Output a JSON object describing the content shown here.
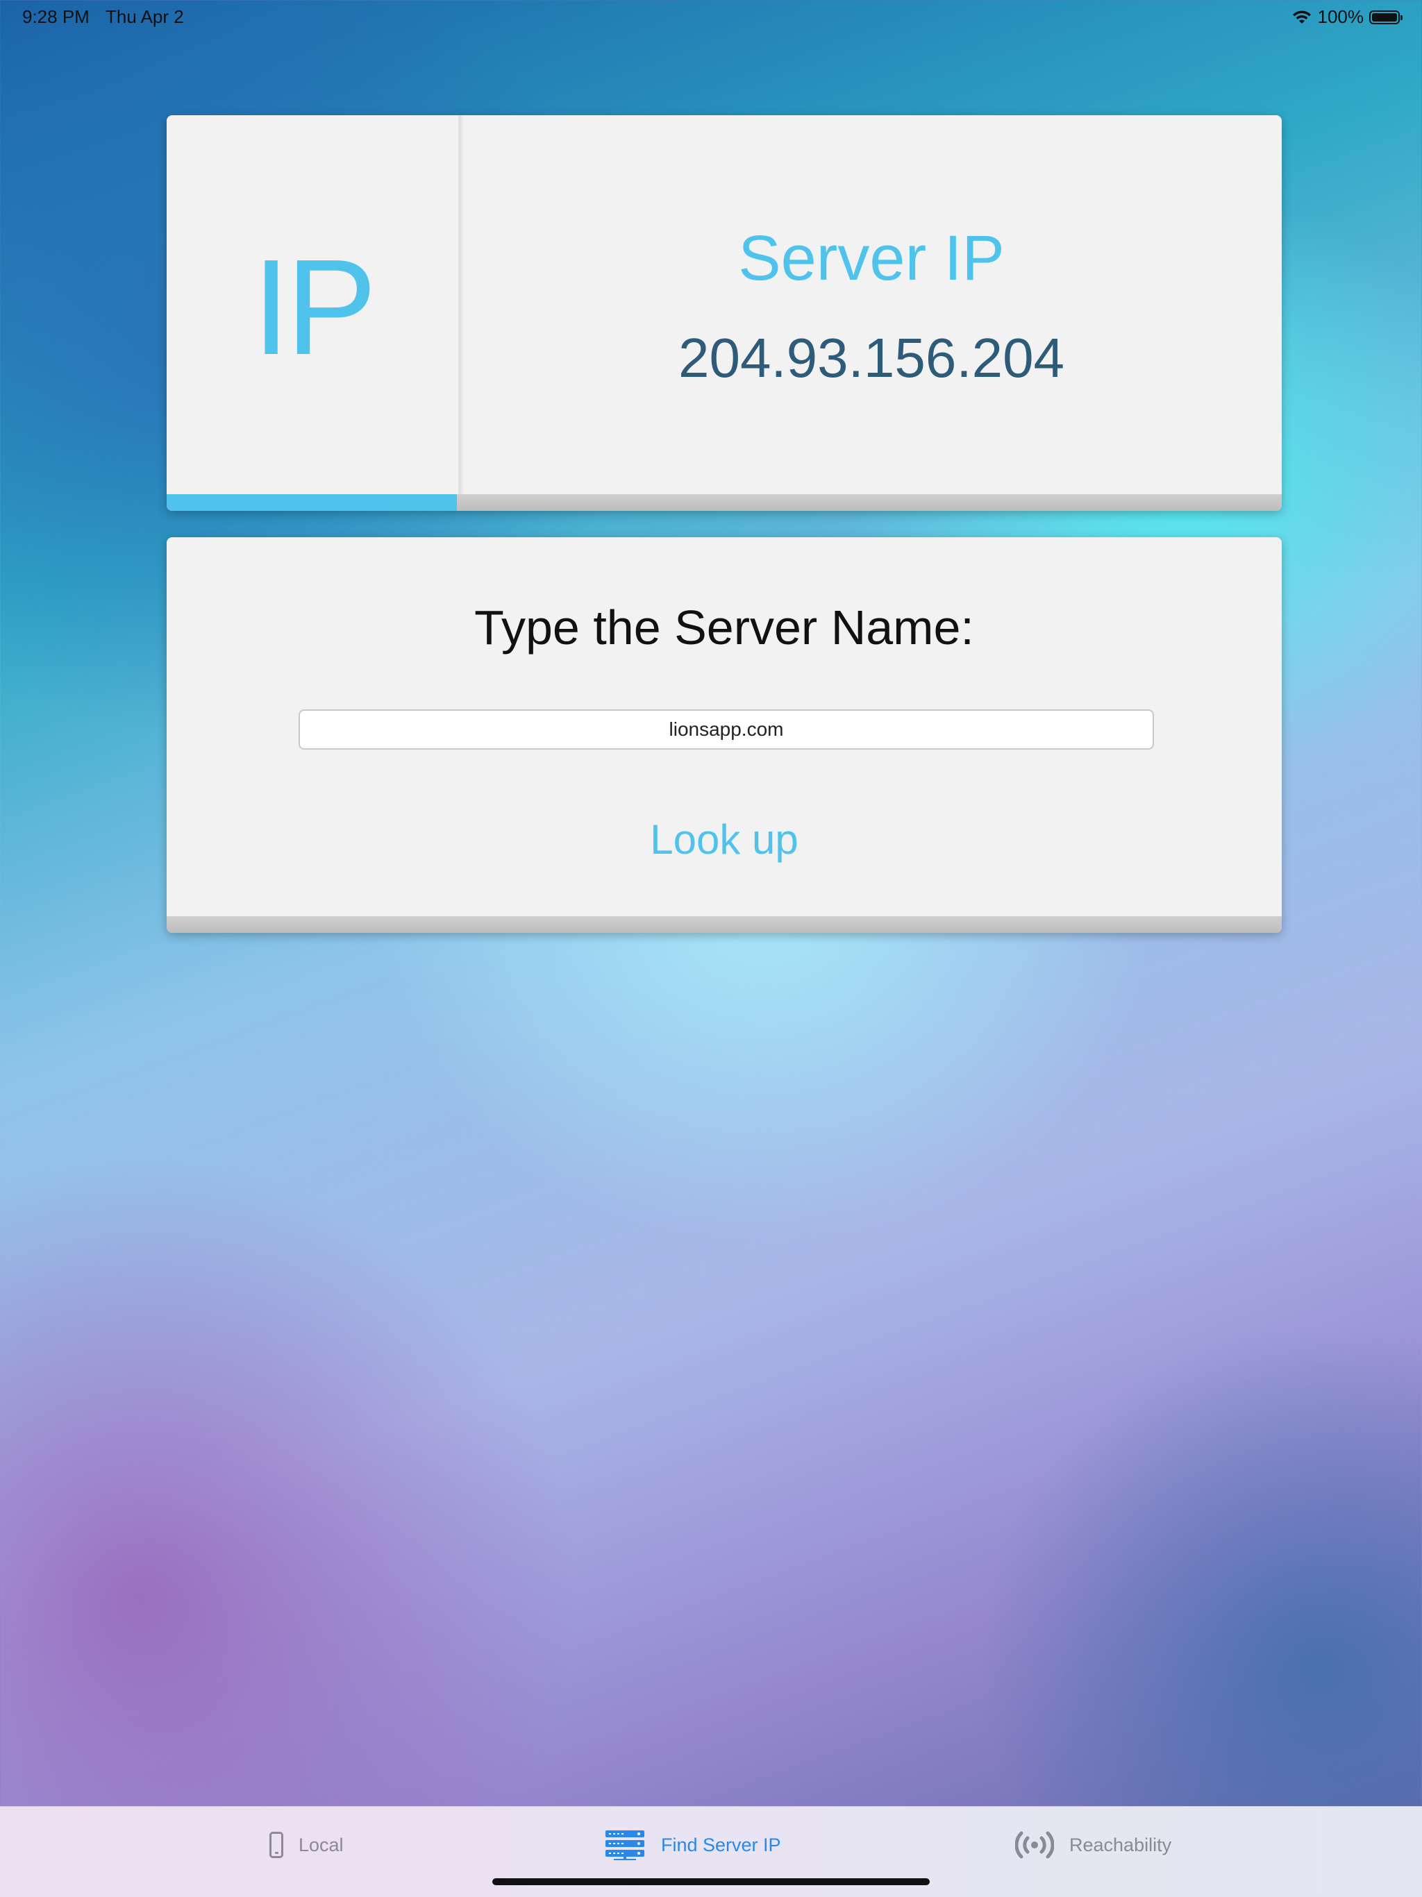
{
  "status_bar": {
    "time": "9:28 PM",
    "date": "Thu Apr 2",
    "battery": "100%"
  },
  "result_card": {
    "icon_text": "IP",
    "label": "Server IP",
    "ip_address": "204.93.156.204",
    "progress_percent": 26
  },
  "lookup_card": {
    "prompt": "Type the Server Name:",
    "server_name": "lionsapp.com",
    "button_label": "Look up"
  },
  "tab_bar": {
    "tabs": [
      {
        "label": "Local",
        "icon": "phone-icon",
        "selected": false
      },
      {
        "label": "Find Server IP",
        "icon": "server-icon",
        "selected": true
      },
      {
        "label": "Reachability",
        "icon": "broadcast-icon",
        "selected": false
      }
    ]
  },
  "colors": {
    "accent": "#4fc3ec",
    "ip_text": "#2e5b78",
    "tab_selected": "#2a88e8",
    "tab_unselected": "#8a8a94"
  }
}
